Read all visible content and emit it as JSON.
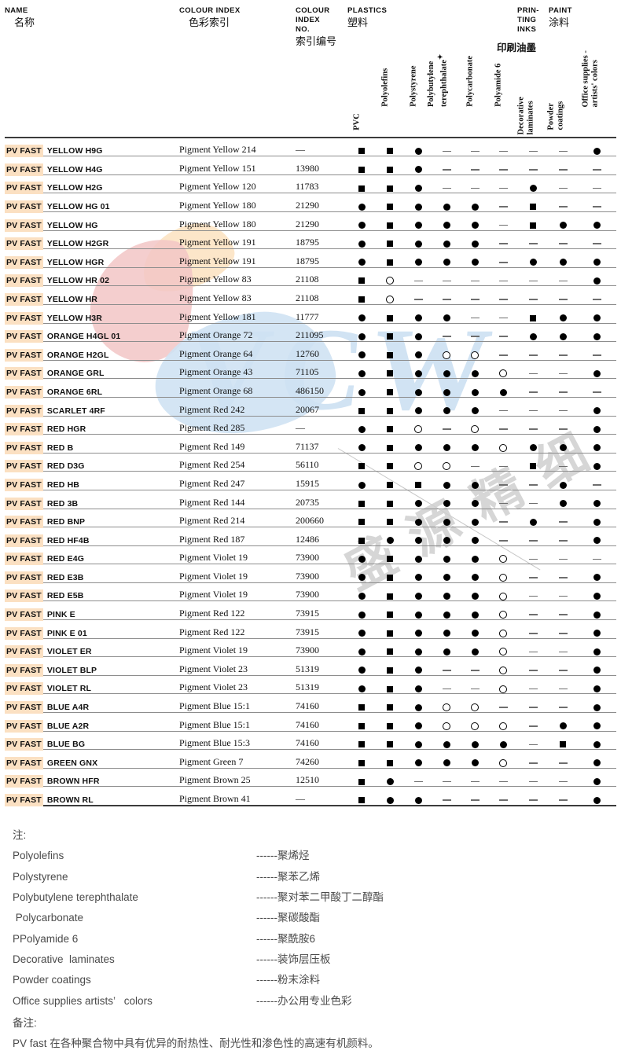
{
  "header": {
    "col_name": {
      "en": "NAME",
      "cn": "名称"
    },
    "col_colour_index": {
      "en": "COLOUR INDEX",
      "cn": "色彩索引"
    },
    "col_colour_index_no": {
      "en": "COLOUR INDEX NO.",
      "en_l1": "COLOUR",
      "en_l2": "INDEX",
      "en_l3": "NO.",
      "cn": "索引编号"
    },
    "group_plastics": {
      "en": "PLASTICS",
      "cn": "塑料"
    },
    "group_printing_inks": {
      "en_l1": "PRIN-",
      "en_l2": "TING",
      "en_l3": "INKS",
      "cn": "印刷油墨"
    },
    "group_paint": {
      "en": "PAINT",
      "cn": "涂料"
    },
    "sub_columns": [
      {
        "label": "PVC",
        "sup": ""
      },
      {
        "label": "Polyolefins",
        "sup": ""
      },
      {
        "label": "Polystyrene",
        "sup": ""
      },
      {
        "label_l1": "Polybutylene",
        "label_l2": "terephthalate",
        "sup": "✦"
      },
      {
        "label": "Polycarbonate",
        "sup": ""
      },
      {
        "label": "Polyamide 6",
        "sup": ""
      },
      {
        "label_l1": "Decorative",
        "label_l2": "laminates",
        "sup": ""
      },
      {
        "label_l1": "Powder",
        "label_l2": "coatings",
        "sup": ""
      },
      {
        "label_l1": "Office supplies -",
        "label_l2": "artists' colors",
        "sup": ""
      }
    ]
  },
  "brand_prefix": "PV FAST",
  "symbols": {
    "square": "■",
    "circle": "●",
    "open_circle": "○",
    "dash": "—"
  },
  "rows": [
    {
      "name": "YELLOW H9G",
      "ci": "Pigment Yellow 214",
      "cino": "—",
      "marks": [
        "square",
        "square",
        "circle",
        "dash",
        "dash",
        "dash",
        "dash",
        "dash",
        "circle"
      ]
    },
    {
      "name": "YELLOW H4G",
      "ci": "Pigment Yellow 151",
      "cino": "13980",
      "marks": [
        "square",
        "square",
        "circle",
        "dash",
        "dash",
        "dash",
        "dash",
        "dash",
        "dash"
      ]
    },
    {
      "name": "YELLOW H2G",
      "ci": "Pigment Yellow 120",
      "cino": "11783",
      "marks": [
        "square",
        "square",
        "circle",
        "dash",
        "dash",
        "dash",
        "circle",
        "dash",
        "dash"
      ]
    },
    {
      "name": "YELLOW HG 01",
      "ci": "Pigment Yellow 180",
      "cino": "21290",
      "marks": [
        "circle",
        "square",
        "circle",
        "circle",
        "circle",
        "dash",
        "square",
        "dash",
        "dash"
      ]
    },
    {
      "name": "YELLOW HG",
      "ci": "Pigment Yellow 180",
      "cino": "21290",
      "marks": [
        "circle",
        "square",
        "circle",
        "circle",
        "circle",
        "dash",
        "square",
        "circle",
        "circle"
      ]
    },
    {
      "name": "YELLOW H2GR",
      "ci": "Pigment Yellow 191",
      "cino": "18795",
      "marks": [
        "circle",
        "square",
        "circle",
        "circle",
        "circle",
        "dash",
        "dash",
        "dash",
        "dash"
      ]
    },
    {
      "name": "YELLOW HGR",
      "ci": "Pigment Yellow 191",
      "cino": "18795",
      "marks": [
        "circle",
        "square",
        "circle",
        "circle",
        "circle",
        "dash",
        "circle",
        "circle",
        "circle"
      ]
    },
    {
      "name": "YELLOW HR 02",
      "ci": "Pigment Yellow 83",
      "cino": "21108",
      "marks": [
        "square",
        "open_circle",
        "dash",
        "dash",
        "dash",
        "dash",
        "dash",
        "dash",
        "circle"
      ]
    },
    {
      "name": "YELLOW HR",
      "ci": "Pigment Yellow 83",
      "cino": "21108",
      "marks": [
        "square",
        "open_circle",
        "dash",
        "dash",
        "dash",
        "dash",
        "dash",
        "dash",
        "dash"
      ]
    },
    {
      "name": "YELLOW H3R",
      "ci": "Pigment Yellow 181",
      "cino": "11777",
      "marks": [
        "circle",
        "square",
        "circle",
        "circle",
        "dash",
        "dash",
        "square",
        "circle",
        "circle"
      ]
    },
    {
      "name": "ORANGE H4GL 01",
      "ci": "Pigment Orange 72",
      "cino": "211095",
      "marks": [
        "circle",
        "square",
        "circle",
        "dash",
        "dash",
        "dash",
        "circle",
        "circle",
        "circle"
      ]
    },
    {
      "name": "ORANGE H2GL",
      "ci": "Pigment Orange 64",
      "cino": "12760",
      "marks": [
        "circle",
        "square",
        "circle",
        "open_circle",
        "open_circle",
        "dash",
        "dash",
        "dash",
        "dash"
      ]
    },
    {
      "name": "ORANGE GRL",
      "ci": "Pigment Orange 43",
      "cino": "71105",
      "marks": [
        "circle",
        "square",
        "circle",
        "circle",
        "circle",
        "open_circle",
        "dash",
        "dash",
        "circle"
      ]
    },
    {
      "name": "ORANGE 6RL",
      "ci": "Pigment Orange 68",
      "cino": "486150",
      "marks": [
        "circle",
        "square",
        "circle",
        "circle",
        "circle",
        "circle",
        "dash",
        "dash",
        "dash"
      ]
    },
    {
      "name": "SCARLET 4RF",
      "ci": "Pigment Red 242",
      "cino": "20067",
      "marks": [
        "square",
        "square",
        "circle",
        "circle",
        "circle",
        "dash",
        "dash",
        "dash",
        "circle"
      ]
    },
    {
      "name": "RED HGR",
      "ci": "Pigment Red 285",
      "cino": "—",
      "marks": [
        "circle",
        "square",
        "open_circle",
        "dash",
        "open_circle",
        "dash",
        "dash",
        "dash",
        "circle"
      ]
    },
    {
      "name": "RED B",
      "ci": "Pigment Red 149",
      "cino": "71137",
      "marks": [
        "circle",
        "square",
        "circle",
        "circle",
        "circle",
        "open_circle",
        "circle",
        "circle",
        "circle"
      ]
    },
    {
      "name": "RED D3G",
      "ci": "Pigment Red 254",
      "cino": "56110",
      "marks": [
        "square",
        "square",
        "open_circle",
        "open_circle",
        "dash",
        "dash",
        "square",
        "dash",
        "circle"
      ]
    },
    {
      "name": "RED HB",
      "ci": "Pigment Red 247",
      "cino": "15915",
      "marks": [
        "circle",
        "square",
        "square",
        "circle",
        "circle",
        "dash",
        "dash",
        "circle",
        "dash"
      ]
    },
    {
      "name": "RED 3B",
      "ci": "Pigment Red 144",
      "cino": "20735",
      "marks": [
        "square",
        "square",
        "circle",
        "circle",
        "circle",
        "dash",
        "dash",
        "circle",
        "circle"
      ]
    },
    {
      "name": "RED BNP",
      "ci": "Pigment Red 214",
      "cino": "200660",
      "marks": [
        "square",
        "square",
        "circle",
        "circle",
        "circle",
        "dash",
        "circle",
        "dash",
        "circle"
      ]
    },
    {
      "name": "RED HF4B",
      "ci": "Pigment Red 187",
      "cino": "12486",
      "marks": [
        "square",
        "circle",
        "circle",
        "circle",
        "circle",
        "dash",
        "dash",
        "dash",
        "circle"
      ]
    },
    {
      "name": "RED E4G",
      "ci": "Pigment Violet 19",
      "cino": "73900",
      "marks": [
        "circle",
        "square",
        "circle",
        "circle",
        "circle",
        "open_circle",
        "dash",
        "dash",
        "dash"
      ]
    },
    {
      "name": "RED E3B",
      "ci": "Pigment Violet 19",
      "cino": "73900",
      "marks": [
        "circle",
        "square",
        "circle",
        "circle",
        "circle",
        "open_circle",
        "dash",
        "dash",
        "circle"
      ]
    },
    {
      "name": "RED E5B",
      "ci": "Pigment Violet 19",
      "cino": "73900",
      "marks": [
        "circle",
        "square",
        "circle",
        "circle",
        "circle",
        "open_circle",
        "dash",
        "dash",
        "circle"
      ]
    },
    {
      "name": "PINK E",
      "ci": "Pigment Red 122",
      "cino": "73915",
      "marks": [
        "circle",
        "square",
        "circle",
        "circle",
        "circle",
        "open_circle",
        "dash",
        "dash",
        "circle"
      ]
    },
    {
      "name": "PINK E 01",
      "ci": "Pigment Red 122",
      "cino": "73915",
      "marks": [
        "circle",
        "square",
        "circle",
        "circle",
        "circle",
        "open_circle",
        "dash",
        "dash",
        "circle"
      ]
    },
    {
      "name": "VIOLET ER",
      "ci": "Pigment Violet 19",
      "cino": "73900",
      "marks": [
        "circle",
        "square",
        "circle",
        "circle",
        "circle",
        "open_circle",
        "dash",
        "dash",
        "circle"
      ]
    },
    {
      "name": "VIOLET BLP",
      "ci": "Pigment Violet 23",
      "cino": "51319",
      "marks": [
        "circle",
        "square",
        "circle",
        "dash",
        "dash",
        "open_circle",
        "dash",
        "dash",
        "circle"
      ]
    },
    {
      "name": "VIOLET RL",
      "ci": "Pigment Violet 23",
      "cino": "51319",
      "marks": [
        "circle",
        "square",
        "circle",
        "dash",
        "dash",
        "open_circle",
        "dash",
        "dash",
        "circle"
      ]
    },
    {
      "name": "BLUE A4R",
      "ci": "Pigment Blue 15:1",
      "cino": "74160",
      "marks": [
        "square",
        "square",
        "circle",
        "open_circle",
        "open_circle",
        "dash",
        "dash",
        "dash",
        "circle"
      ]
    },
    {
      "name": "BLUE A2R",
      "ci": "Pigment Blue 15:1",
      "cino": "74160",
      "marks": [
        "square",
        "square",
        "circle",
        "open_circle",
        "open_circle",
        "open_circle",
        "dash",
        "circle",
        "circle"
      ]
    },
    {
      "name": "BLUE BG",
      "ci": "Pigment Blue 15:3",
      "cino": "74160",
      "marks": [
        "square",
        "square",
        "circle",
        "circle",
        "circle",
        "circle",
        "dash",
        "square",
        "circle"
      ]
    },
    {
      "name": "GREEN GNX",
      "ci": "Pigment Green 7",
      "cino": "74260",
      "marks": [
        "square",
        "square",
        "circle",
        "circle",
        "circle",
        "open_circle",
        "dash",
        "dash",
        "circle"
      ]
    },
    {
      "name": "BROWN HFR",
      "ci": "Pigment Brown 25",
      "cino": "12510",
      "marks": [
        "square",
        "circle",
        "dash",
        "dash",
        "dash",
        "dash",
        "dash",
        "dash",
        "circle"
      ]
    },
    {
      "name": "BROWN RL",
      "ci": "Pigment Brown 41",
      "cino": "—",
      "marks": [
        "square",
        "circle",
        "circle",
        "dash",
        "dash",
        "dash",
        "dash",
        "dash",
        "circle"
      ]
    }
  ],
  "notes": {
    "title": "注:",
    "items": [
      {
        "en": "Polyolefins",
        "cn": "------聚烯烃"
      },
      {
        "en": "Polystyrene",
        "cn": "------聚苯乙烯"
      },
      {
        "en": "Polybutylene terephthalate",
        "cn": "------聚对苯二甲酸丁二醇酯"
      },
      {
        "en": " Polycarbonate",
        "cn": "------聚碳酸酯"
      },
      {
        "en": "PPolyamide 6",
        "cn": "------聚酰胺6"
      },
      {
        "en": "Decorative  laminates",
        "cn": "------装饰层压板"
      },
      {
        "en": "Powder coatings",
        "cn": "------粉末涂料"
      },
      {
        "en": "Office supplies artists’   colors",
        "cn": "------办公用专业色彩"
      }
    ],
    "remark_title": "备注:",
    "remark_body": "PV fast 在各种聚合物中具有优异的耐热性、耐光性和渗色性的高速有机颜料。"
  },
  "watermark": {
    "letters": "VCW",
    "cjk": "盛 源 精 细",
    "color_blue": "#cfe2f3",
    "color_pink": "#f2c6c6",
    "color_yellow": "#fbe2c0",
    "color_grey": "#cfcfcf"
  },
  "accent_color": "#fbe0c2"
}
